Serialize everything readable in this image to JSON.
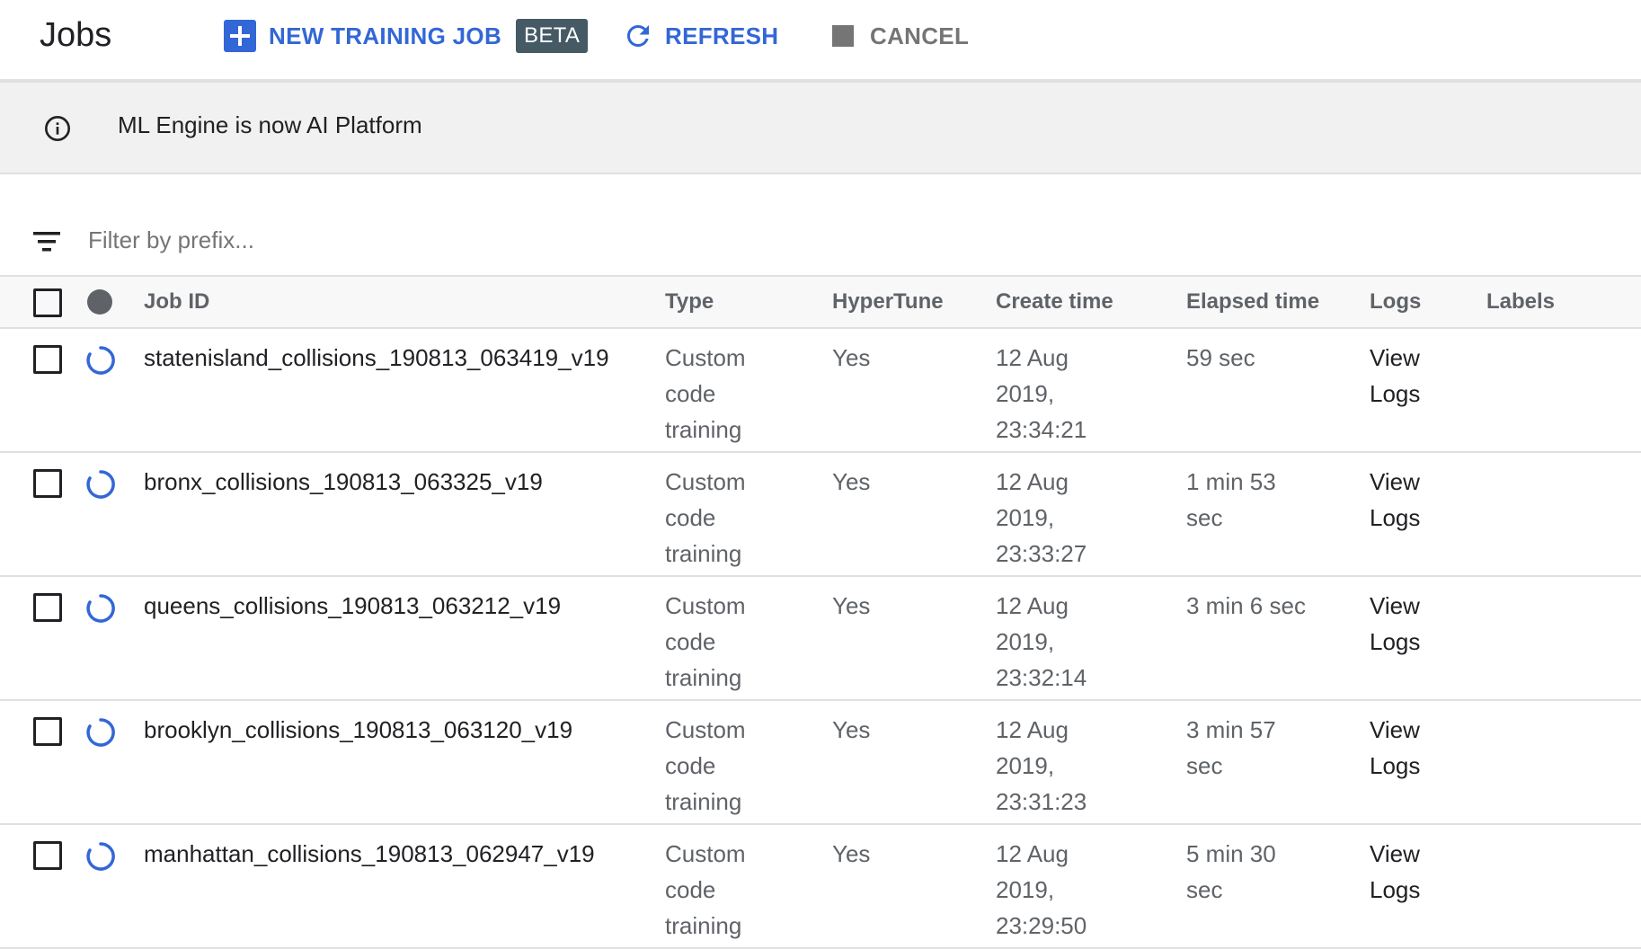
{
  "header": {
    "title": "Jobs",
    "new_job_label": "NEW TRAINING JOB",
    "beta_label": "BETA",
    "refresh_label": "REFRESH",
    "cancel_label": "CANCEL"
  },
  "banner": {
    "text": "ML Engine is now AI Platform"
  },
  "filter": {
    "placeholder": "Filter by prefix..."
  },
  "table": {
    "columns": {
      "job_id": "Job ID",
      "type": "Type",
      "hypertune": "HyperTune",
      "create_time": "Create time",
      "elapsed_time": "Elapsed time",
      "logs": "Logs",
      "labels": "Labels"
    },
    "rows": [
      {
        "job_id": "statenisland_collisions_190813_063419_v19",
        "type": [
          "Custom",
          "code",
          "training"
        ],
        "hypertune": "Yes",
        "create_time": [
          "12 Aug",
          "2019,",
          "23:34:21"
        ],
        "elapsed_time": [
          "59 sec"
        ],
        "logs": [
          "View",
          "Logs"
        ],
        "labels": ""
      },
      {
        "job_id": "bronx_collisions_190813_063325_v19",
        "type": [
          "Custom",
          "code",
          "training"
        ],
        "hypertune": "Yes",
        "create_time": [
          "12 Aug",
          "2019,",
          "23:33:27"
        ],
        "elapsed_time": [
          "1 min 53",
          "sec"
        ],
        "logs": [
          "View",
          "Logs"
        ],
        "labels": ""
      },
      {
        "job_id": "queens_collisions_190813_063212_v19",
        "type": [
          "Custom",
          "code",
          "training"
        ],
        "hypertune": "Yes",
        "create_time": [
          "12 Aug",
          "2019,",
          "23:32:14"
        ],
        "elapsed_time": [
          "3 min 6 sec"
        ],
        "logs": [
          "View",
          "Logs"
        ],
        "labels": ""
      },
      {
        "job_id": "brooklyn_collisions_190813_063120_v19",
        "type": [
          "Custom",
          "code",
          "training"
        ],
        "hypertune": "Yes",
        "create_time": [
          "12 Aug",
          "2019,",
          "23:31:23"
        ],
        "elapsed_time": [
          "3 min 57",
          "sec"
        ],
        "logs": [
          "View",
          "Logs"
        ],
        "labels": ""
      },
      {
        "job_id": "manhattan_collisions_190813_062947_v19",
        "type": [
          "Custom",
          "code",
          "training"
        ],
        "hypertune": "Yes",
        "create_time": [
          "12 Aug",
          "2019,",
          "23:29:50"
        ],
        "elapsed_time": [
          "5 min 30",
          "sec"
        ],
        "logs": [
          "View",
          "Logs"
        ],
        "labels": ""
      }
    ]
  },
  "colors": {
    "accent": "#3367d6",
    "beta_badge": "#455a64",
    "cancel_gray": "#757575",
    "banner_bg": "#f1f1f1",
    "spinner": "#3367d6"
  },
  "icons": {
    "new_job": "plus-box-icon",
    "refresh": "refresh-icon",
    "cancel": "stop-icon",
    "banner": "info-icon",
    "filter": "filter-list-icon",
    "status_header": "status-dot-icon",
    "status_running": "spinner-icon"
  }
}
